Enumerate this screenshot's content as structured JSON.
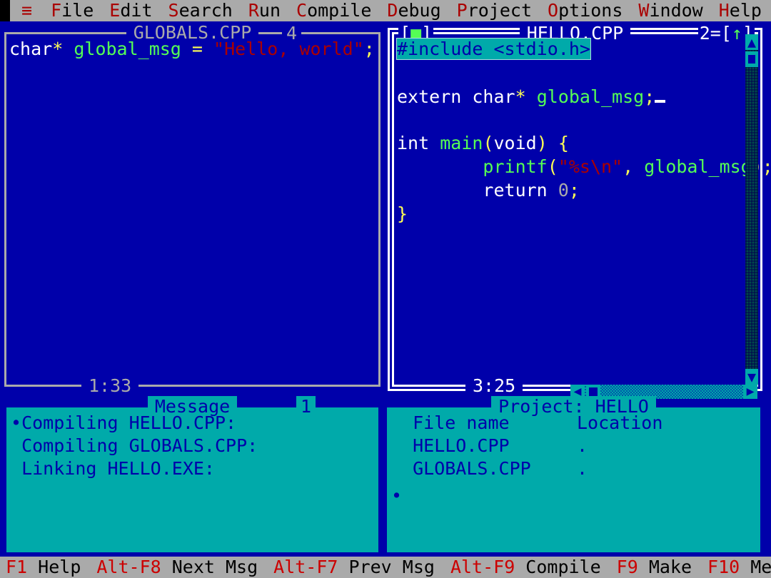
{
  "menubar": {
    "system_icon": "≡",
    "items": [
      {
        "name": "file",
        "hotkey": "F",
        "rest": "ile"
      },
      {
        "name": "edit",
        "hotkey": "E",
        "rest": "dit"
      },
      {
        "name": "search",
        "hotkey": "S",
        "rest": "earch"
      },
      {
        "name": "run",
        "hotkey": "R",
        "rest": "un"
      },
      {
        "name": "compile",
        "hotkey": "C",
        "rest": "ompile"
      },
      {
        "name": "debug",
        "hotkey": "D",
        "rest": "ebug"
      },
      {
        "name": "project",
        "hotkey": "P",
        "rest": "roject"
      },
      {
        "name": "options",
        "hotkey": "O",
        "rest": "ptions"
      },
      {
        "name": "window",
        "hotkey": "W",
        "rest": "indow"
      },
      {
        "name": "help",
        "hotkey": "H",
        "rest": "elp"
      }
    ]
  },
  "globals_window": {
    "title": "GLOBALS.CPP",
    "number": "4",
    "position": "1:33",
    "active": false,
    "lines": [
      [
        {
          "t": "char",
          "c": "kw"
        },
        {
          "t": "*",
          "c": "pun"
        },
        {
          "t": " ",
          "c": "kw"
        },
        {
          "t": "global_msg",
          "c": "id"
        },
        {
          "t": " ",
          "c": "kw"
        },
        {
          "t": "=",
          "c": "pun"
        },
        {
          "t": " ",
          "c": "kw"
        },
        {
          "t": "\"Hello, world\"",
          "c": "str"
        },
        {
          "t": ";",
          "c": "pun"
        }
      ]
    ]
  },
  "hello_window": {
    "title": "HELLO.CPP",
    "number": "2",
    "position": "3:25",
    "active": true,
    "close_box": {
      "left": "[",
      "glyph": "■",
      "right": "]"
    },
    "zoom_box": {
      "left": "[",
      "glyph": "↑",
      "right": "]"
    },
    "number_sep": "=",
    "lines": [
      {
        "selected": true,
        "parts": [
          {
            "t": "#include <stdio.h>",
            "c": "pre"
          }
        ]
      },
      {
        "selected": false,
        "parts": []
      },
      {
        "selected": false,
        "parts": [
          {
            "t": "extern char",
            "c": "kw"
          },
          {
            "t": "*",
            "c": "pun"
          },
          {
            "t": " ",
            "c": "kw"
          },
          {
            "t": "global_msg",
            "c": "id"
          },
          {
            "t": ";",
            "c": "pun"
          },
          {
            "t": "CARET",
            "c": "caret"
          }
        ]
      },
      {
        "selected": false,
        "parts": []
      },
      {
        "selected": false,
        "parts": [
          {
            "t": "int ",
            "c": "kw"
          },
          {
            "t": "main",
            "c": "id"
          },
          {
            "t": "(",
            "c": "pun"
          },
          {
            "t": "void",
            "c": "kw"
          },
          {
            "t": ") ",
            "c": "pun"
          },
          {
            "t": "{",
            "c": "pun"
          }
        ]
      },
      {
        "selected": false,
        "parts": [
          {
            "t": "        ",
            "c": "kw"
          },
          {
            "t": "printf",
            "c": "id"
          },
          {
            "t": "(",
            "c": "pun"
          },
          {
            "t": "\"%s\\n\"",
            "c": "str"
          },
          {
            "t": ", ",
            "c": "pun"
          },
          {
            "t": "global_msg",
            "c": "id"
          },
          {
            "t": ")",
            "c": "pun"
          },
          {
            "t": ";",
            "c": "pun"
          }
        ]
      },
      {
        "selected": false,
        "parts": [
          {
            "t": "        ",
            "c": "kw"
          },
          {
            "t": "return ",
            "c": "kw"
          },
          {
            "t": "0",
            "c": "num"
          },
          {
            "t": ";",
            "c": "pun"
          }
        ]
      },
      {
        "selected": false,
        "parts": [
          {
            "t": "}",
            "c": "pun"
          }
        ]
      }
    ],
    "vscroll": {
      "up": "▲",
      "down": "▼"
    },
    "hscroll": {
      "left": "◀",
      "right": "▶"
    }
  },
  "message_window": {
    "title": "Message",
    "number": "1",
    "lines": [
      {
        "marker": "•",
        "text": "Compiling HELLO.CPP:"
      },
      {
        "marker": " ",
        "text": "Compiling GLOBALS.CPP:"
      },
      {
        "marker": " ",
        "text": "Linking HELLO.EXE:"
      }
    ]
  },
  "project_window": {
    "title": "Project: HELLO",
    "headers": {
      "name": "File name",
      "location": "Location"
    },
    "rows": [
      {
        "name": "HELLO.CPP",
        "location": "."
      },
      {
        "name": "GLOBALS.CPP",
        "location": "."
      }
    ],
    "marker": "•"
  },
  "statusbar": {
    "items": [
      {
        "key": "F1",
        "label": " Help"
      },
      {
        "key": "Alt-F8",
        "label": " Next Msg"
      },
      {
        "key": "Alt-F7",
        "label": " Prev Msg"
      },
      {
        "key": "Alt-F9",
        "label": " Compile"
      },
      {
        "key": "F9",
        "label": " Make"
      },
      {
        "key": "F10",
        "label": " Menu"
      }
    ]
  },
  "colors": {
    "desktop": "#0000AA",
    "menubar": "#AAAAAA",
    "hotkey": "#AA0000",
    "panel": "#00AAAA",
    "keyword": "#FFFFFF",
    "identifier": "#55FF55",
    "punctuation": "#FFFF55",
    "string": "#AA0000",
    "number": "#AAAAAA",
    "selection": "#00AAAA"
  }
}
